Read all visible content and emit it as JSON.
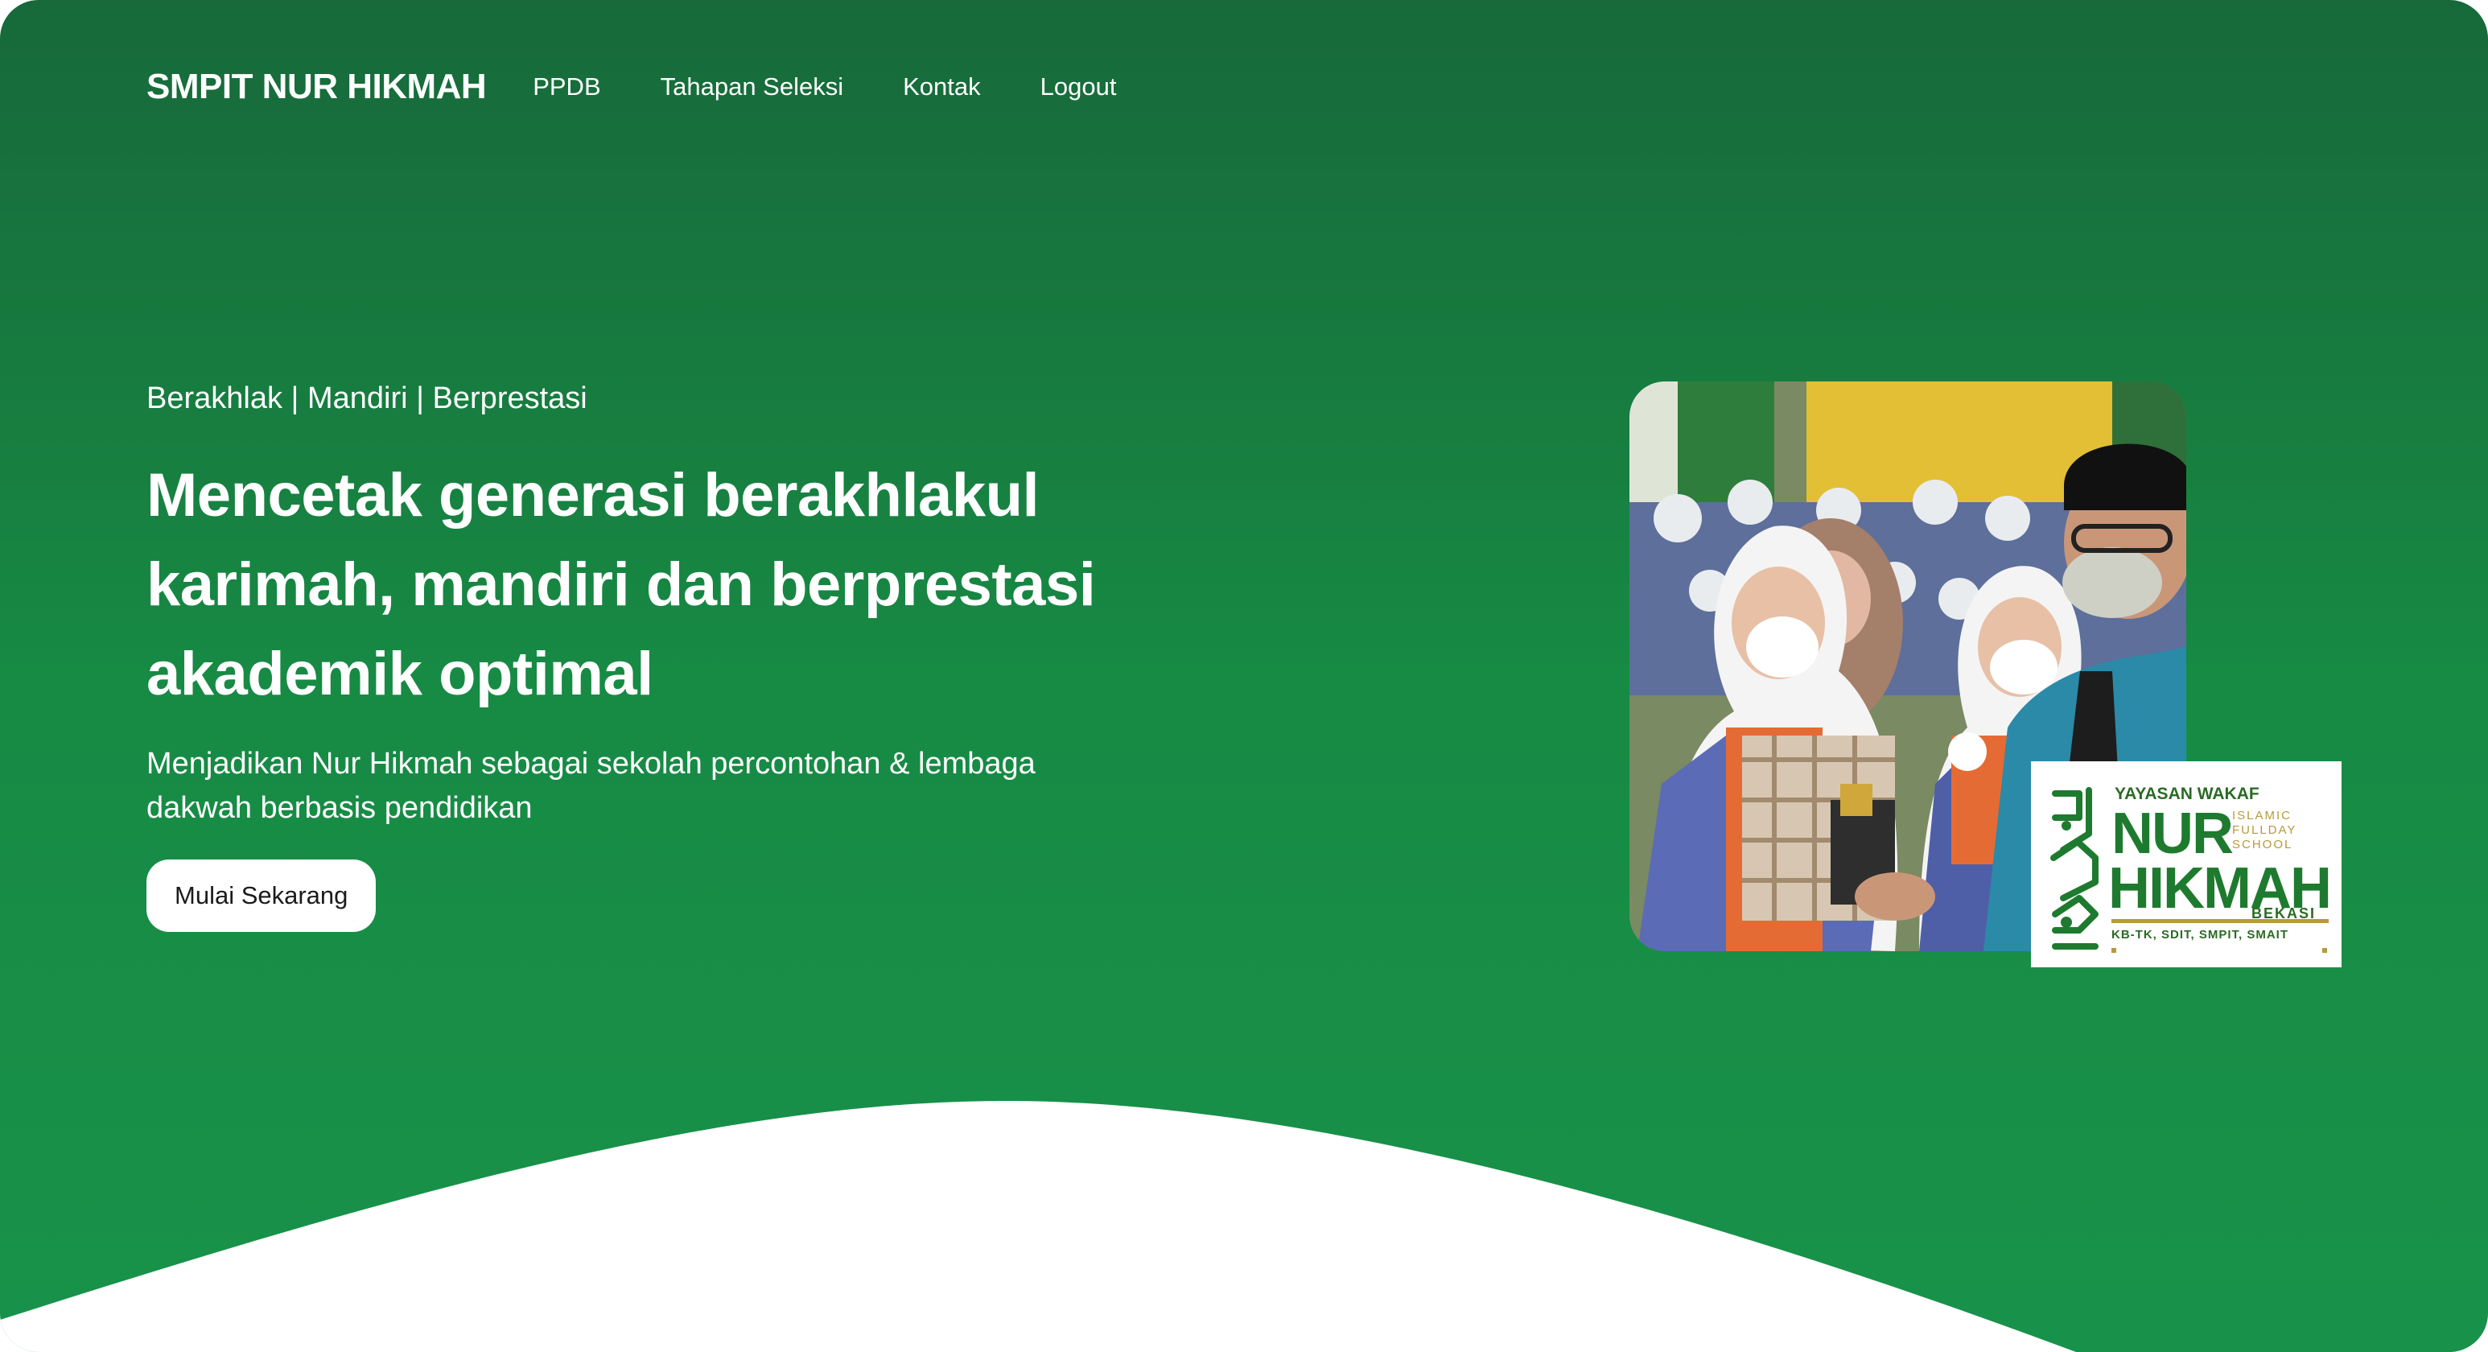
{
  "nav": {
    "brand": "SMPIT NUR HIKMAH",
    "links": [
      "PPDB",
      "Tahapan Seleksi",
      "Kontak",
      "Logout"
    ]
  },
  "hero": {
    "tagline": "Berakhlak | Mandiri | Berprestasi",
    "headline_lines": [
      "Mencetak generasi berakhlakul",
      "karimah, mandiri dan berprestasi",
      "akademik optimal"
    ],
    "subtext_lines": [
      "Menjadikan Nur Hikmah sebagai sekolah percontohan & lembaga",
      "dakwah berbasis pendidikan"
    ],
    "cta_label": "Mulai Sekarang"
  },
  "logo": {
    "line1": "YAYASAN WAKAF",
    "line2": "NUR",
    "line3a": "ISLAMIC",
    "line3b": "FULLDAY",
    "line3c": "SCHOOL",
    "line4": "HIKMAH",
    "line5": "BEKASI",
    "line6": "KB-TK, SDIT, SMPIT, SMAIT"
  },
  "colors": {
    "hero_green": "#178a44",
    "hero_green_dark": "#17693a",
    "logo_green": "#1e7a2e",
    "logo_gold": "#b79a3a"
  }
}
